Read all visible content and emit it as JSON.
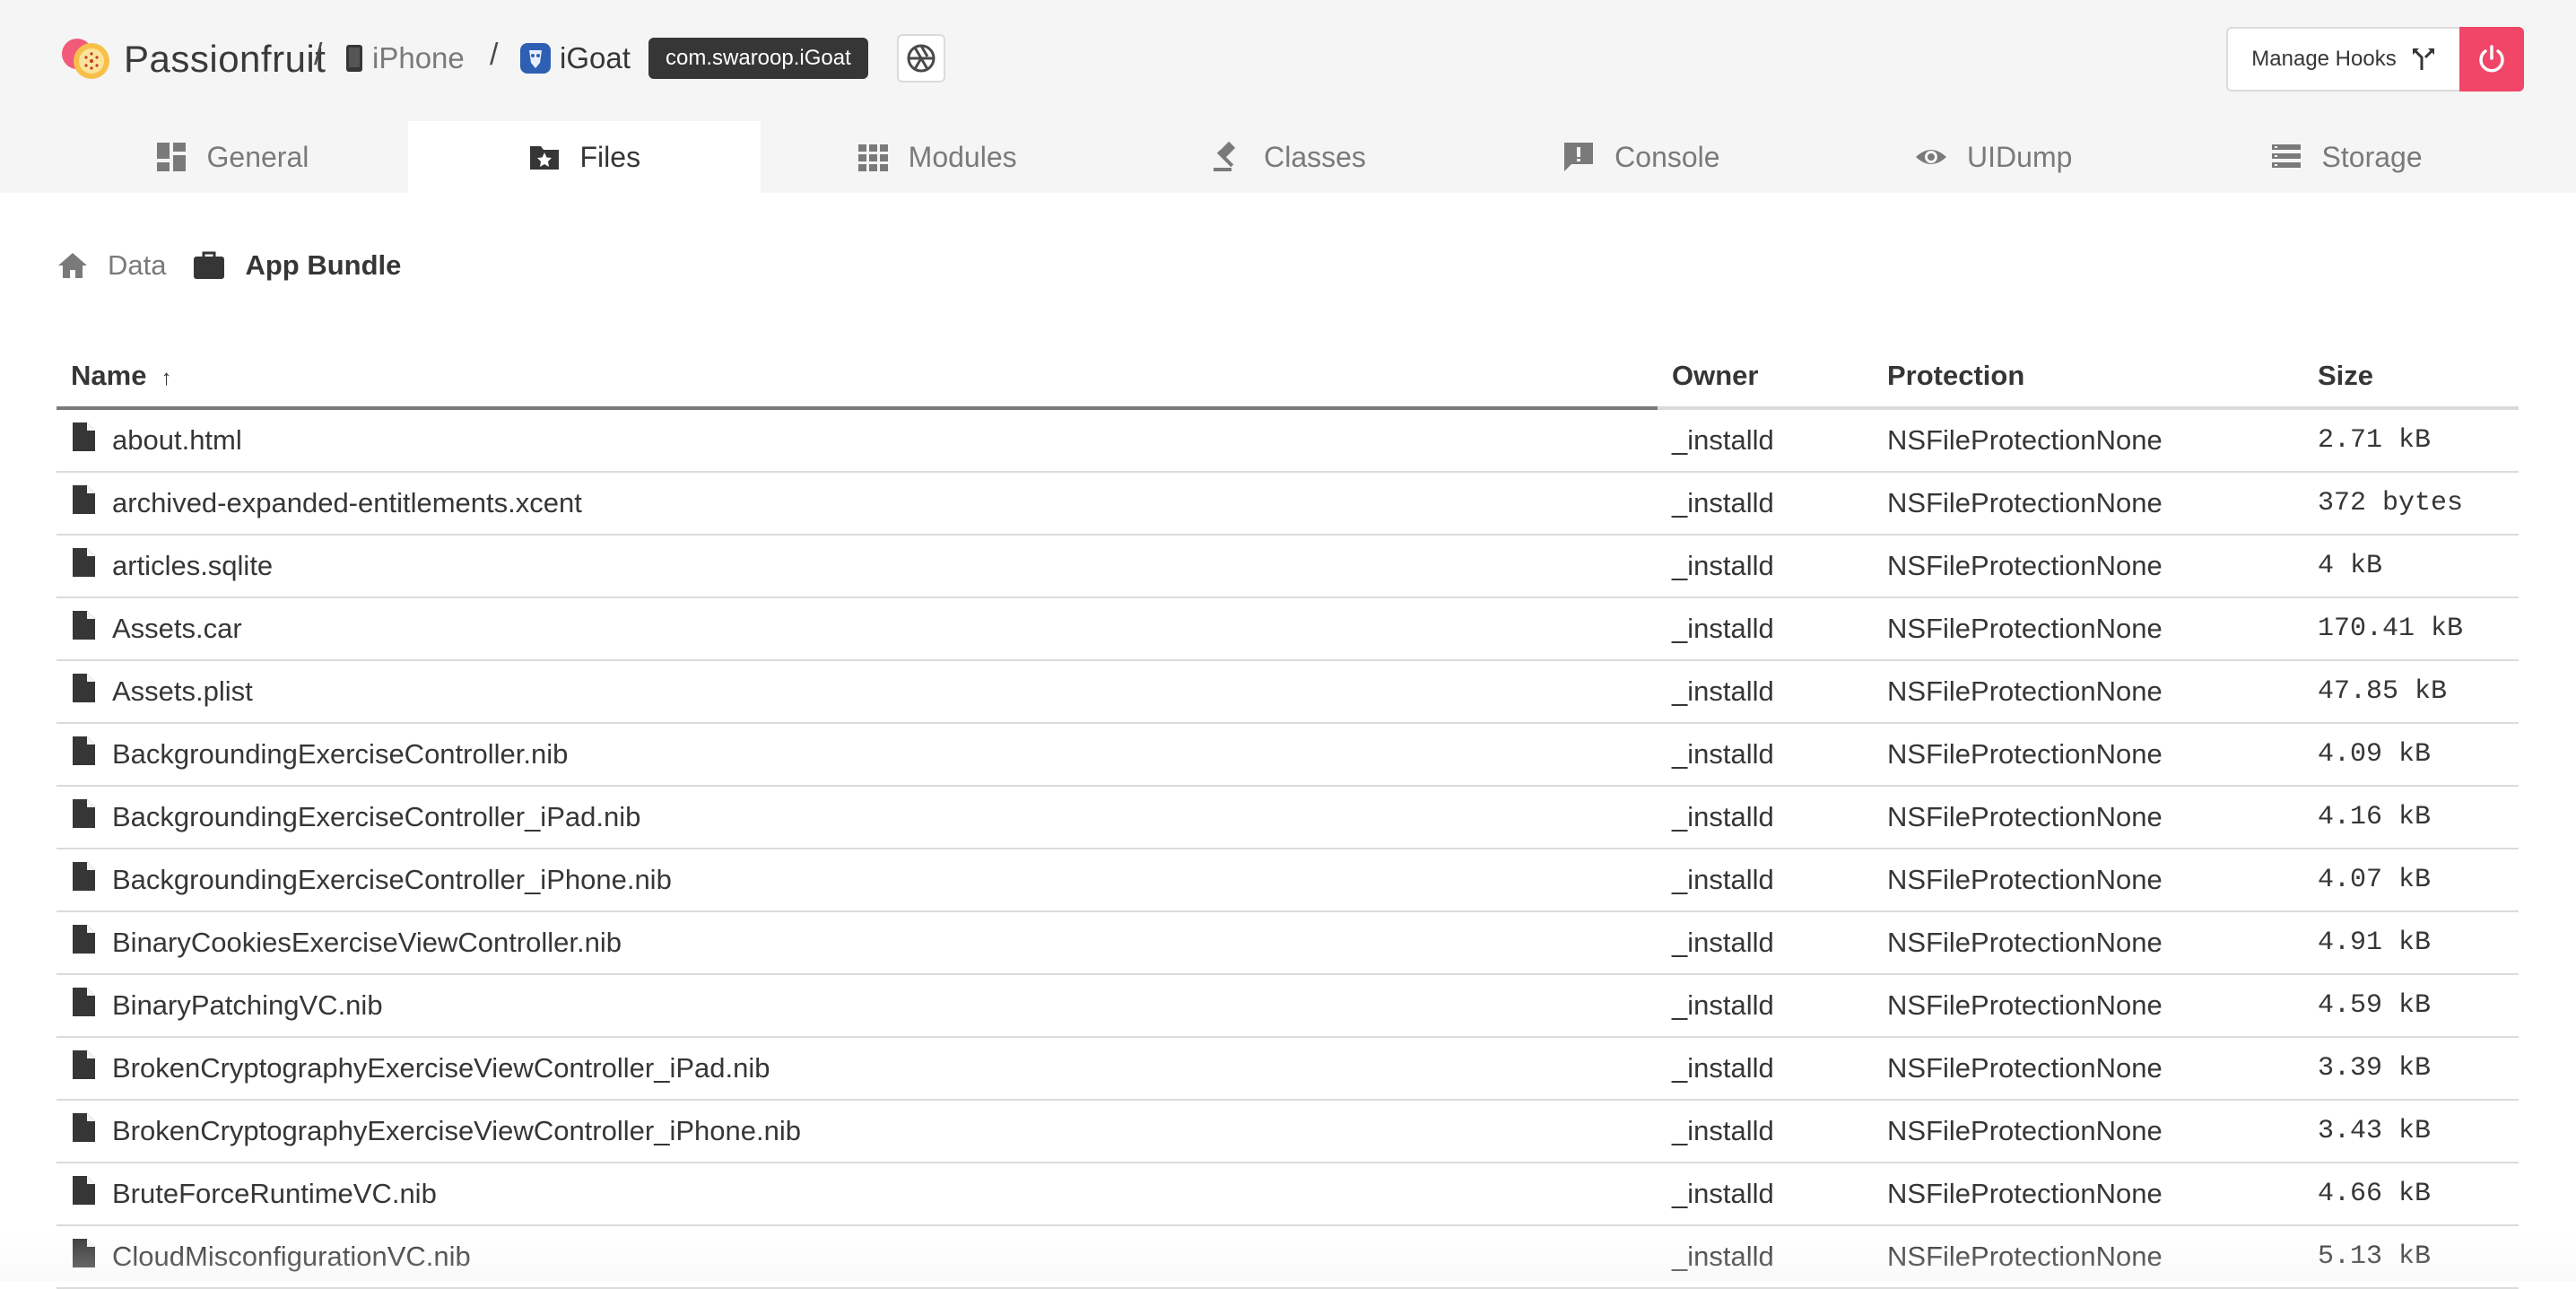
{
  "app": {
    "brand": "Passionfruit",
    "device": "iPhone",
    "app_name": "iGoat",
    "bundle_id": "com.swaroop.iGoat",
    "breadcrumb_separator": "/"
  },
  "actions": {
    "manage_hooks": "Manage Hooks",
    "accent_color": "#f14668"
  },
  "tabs": [
    {
      "label": "General",
      "icon": "dashboard-icon"
    },
    {
      "label": "Files",
      "icon": "folder-star-icon",
      "active": true
    },
    {
      "label": "Modules",
      "icon": "grid-icon"
    },
    {
      "label": "Classes",
      "icon": "gavel-icon"
    },
    {
      "label": "Console",
      "icon": "alert-message-icon"
    },
    {
      "label": "UIDump",
      "icon": "eye-icon"
    },
    {
      "label": "Storage",
      "icon": "list-icon"
    }
  ],
  "path": {
    "root": "Data",
    "current": "App Bundle"
  },
  "table": {
    "columns": {
      "name": "Name",
      "owner": "Owner",
      "protection": "Protection",
      "size": "Size"
    },
    "sort_indicator": "↑",
    "rows": [
      {
        "name": "about.html",
        "owner": "_installd",
        "protection": "NSFileProtectionNone",
        "size": "2.71 kB"
      },
      {
        "name": "archived-expanded-entitlements.xcent",
        "owner": "_installd",
        "protection": "NSFileProtectionNone",
        "size": "372 bytes"
      },
      {
        "name": "articles.sqlite",
        "owner": "_installd",
        "protection": "NSFileProtectionNone",
        "size": "4 kB"
      },
      {
        "name": "Assets.car",
        "owner": "_installd",
        "protection": "NSFileProtectionNone",
        "size": "170.41 kB"
      },
      {
        "name": "Assets.plist",
        "owner": "_installd",
        "protection": "NSFileProtectionNone",
        "size": "47.85 kB"
      },
      {
        "name": "BackgroundingExerciseController.nib",
        "owner": "_installd",
        "protection": "NSFileProtectionNone",
        "size": "4.09 kB"
      },
      {
        "name": "BackgroundingExerciseController_iPad.nib",
        "owner": "_installd",
        "protection": "NSFileProtectionNone",
        "size": "4.16 kB"
      },
      {
        "name": "BackgroundingExerciseController_iPhone.nib",
        "owner": "_installd",
        "protection": "NSFileProtectionNone",
        "size": "4.07 kB"
      },
      {
        "name": "BinaryCookiesExerciseViewController.nib",
        "owner": "_installd",
        "protection": "NSFileProtectionNone",
        "size": "4.91 kB"
      },
      {
        "name": "BinaryPatchingVC.nib",
        "owner": "_installd",
        "protection": "NSFileProtectionNone",
        "size": "4.59 kB"
      },
      {
        "name": "BrokenCryptographyExerciseViewController_iPad.nib",
        "owner": "_installd",
        "protection": "NSFileProtectionNone",
        "size": "3.39 kB"
      },
      {
        "name": "BrokenCryptographyExerciseViewController_iPhone.nib",
        "owner": "_installd",
        "protection": "NSFileProtectionNone",
        "size": "3.43 kB"
      },
      {
        "name": "BruteForceRuntimeVC.nib",
        "owner": "_installd",
        "protection": "NSFileProtectionNone",
        "size": "4.66 kB"
      },
      {
        "name": "CloudMisconfigurationVC.nib",
        "owner": "_installd",
        "protection": "NSFileProtectionNone",
        "size": "5.13 kB"
      }
    ]
  }
}
